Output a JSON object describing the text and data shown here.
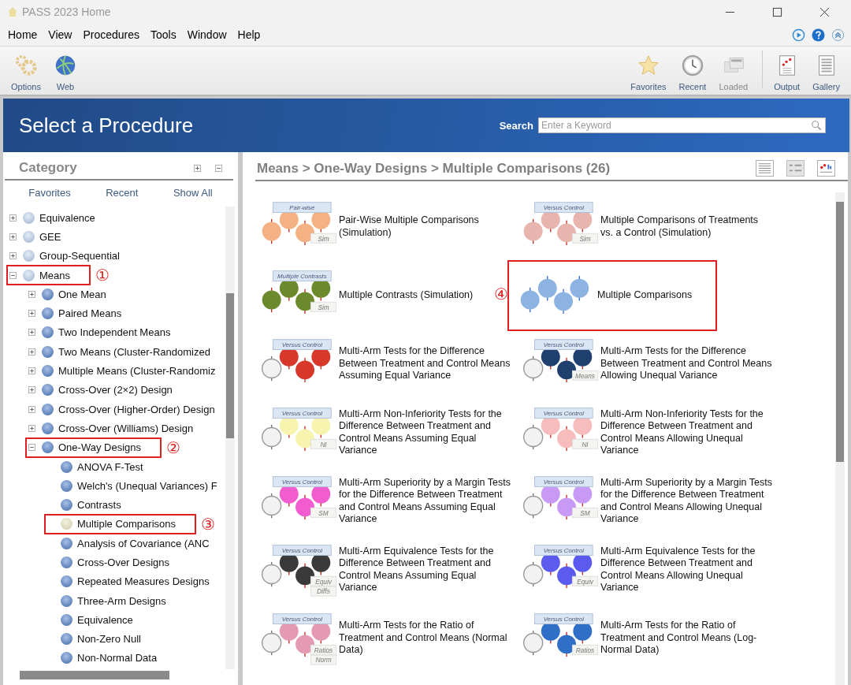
{
  "window": {
    "title": "PASS 2023 Home"
  },
  "menu": [
    "Home",
    "View",
    "Procedures",
    "Tools",
    "Window",
    "Help"
  ],
  "toolbar_left": [
    {
      "kind": "options",
      "label": "Options",
      "disabled": false
    },
    {
      "kind": "web",
      "label": "Web",
      "disabled": false
    }
  ],
  "toolbar_right": [
    {
      "kind": "favorites",
      "label": "Favorites",
      "disabled": false
    },
    {
      "kind": "recent",
      "label": "Recent",
      "disabled": false
    },
    {
      "kind": "loaded",
      "label": "Loaded",
      "disabled": true
    },
    {
      "kind": "output",
      "label": "Output",
      "disabled": false
    },
    {
      "kind": "gallery",
      "label": "Gallery",
      "disabled": false
    }
  ],
  "header": {
    "title": "Select a Procedure",
    "search_label": "Search",
    "search_placeholder": "Enter a Keyword"
  },
  "category": {
    "title": "Category",
    "tabs": [
      "Favorites",
      "Recent",
      "Show All"
    ],
    "tree": [
      {
        "label": "Equivalence",
        "expanded": false,
        "selected": false
      },
      {
        "label": "GEE",
        "expanded": false,
        "selected": false
      },
      {
        "label": "Group-Sequential",
        "expanded": false,
        "selected": false
      },
      {
        "label": "Means",
        "expanded": true,
        "selected": false,
        "callout": "①",
        "children": [
          {
            "label": "One Mean",
            "expanded": false,
            "selected": false
          },
          {
            "label": "Paired Means",
            "expanded": false,
            "selected": false
          },
          {
            "label": "Two Independent Means",
            "expanded": false,
            "selected": false
          },
          {
            "label": "Two Means (Cluster-Randomized",
            "expanded": false,
            "selected": false
          },
          {
            "label": "Multiple Means (Cluster-Randomiz",
            "expanded": false,
            "selected": false
          },
          {
            "label": "Cross-Over (2×2) Design",
            "expanded": false,
            "selected": false
          },
          {
            "label": "Cross-Over (Higher-Order) Design",
            "expanded": false,
            "selected": false
          },
          {
            "label": "Cross-Over (Williams) Design",
            "expanded": false,
            "selected": false
          },
          {
            "label": "One-Way Designs",
            "expanded": true,
            "selected": false,
            "callout": "②",
            "children": [
              {
                "label": "ANOVA F-Test",
                "selected": false
              },
              {
                "label": "Welch's (Unequal Variances) F",
                "selected": false
              },
              {
                "label": "Contrasts",
                "selected": false
              },
              {
                "label": "Multiple Comparisons",
                "selected": true,
                "callout": "③"
              },
              {
                "label": "Analysis of Covariance (ANC",
                "selected": false
              },
              {
                "label": "Cross-Over Designs",
                "selected": false
              },
              {
                "label": "Repeated Measures Designs",
                "selected": false
              },
              {
                "label": "Three-Arm Designs",
                "selected": false
              },
              {
                "label": "Equivalence",
                "selected": false
              },
              {
                "label": "Non-Zero Null",
                "selected": false
              },
              {
                "label": "Non-Normal Data",
                "selected": false
              }
            ]
          }
        ]
      }
    ]
  },
  "procedures": {
    "breadcrumb": "Means > One-Way Designs > Multiple Comparisons (26)",
    "items": [
      {
        "title": "Pair-Wise Multiple Comparisons (Simulation)",
        "color": "#f4b183",
        "banner": "Pair-wise",
        "control": false,
        "tags": [
          "Sim"
        ]
      },
      {
        "title": "Multiple Comparisons of Treatments vs. a Control (Simulation)",
        "color": "#e8b4ae",
        "banner": "Versus Control",
        "control": false,
        "tags": [
          "Sim"
        ]
      },
      {
        "title": "Multiple Contrasts (Simulation)",
        "color": "#6b8a2c",
        "banner": "Multiple Contrasts",
        "control": false,
        "tags": [
          "Sim"
        ]
      },
      {
        "title": "Multiple Comparisons",
        "color": "#8db3e2",
        "control": false,
        "callout": "④"
      },
      {
        "title": "Multi-Arm Tests for the Difference Between Treatment and Control Means Assuming Equal Variance",
        "color": "#d8382a",
        "banner": "Versus Control",
        "control": true
      },
      {
        "title": "Multi-Arm Tests for the Difference Between Treatment and Control Means Allowing Unequal Variance",
        "color": "#1f3f6e",
        "banner": "Versus Control",
        "control": true,
        "tags": [
          "Means"
        ]
      },
      {
        "title": "Multi-Arm Non-Inferiority Tests for the Difference Between Treatment and Control Means Assuming Equal Variance",
        "color": "#f7f4b0",
        "banner": "Versus Control",
        "control": true,
        "tags": [
          "NI"
        ]
      },
      {
        "title": "Multi-Arm Non-Inferiority Tests for the Difference Between Treatment and Control Means Allowing Unequal Variance",
        "color": "#f7bcbc",
        "banner": "Versus Control",
        "control": true,
        "tags": [
          "NI"
        ]
      },
      {
        "title": "Multi-Arm Superiority by a Margin Tests for the Difference Between Treatment and Control Means Assuming Equal Variance",
        "color": "#f25ccf",
        "banner": "Versus Control",
        "control": true,
        "tags": [
          "SM"
        ]
      },
      {
        "title": "Multi-Arm Superiority by a Margin Tests for the Difference Between Treatment and Control Means Allowing Unequal Variance",
        "color": "#c99af5",
        "banner": "Versus Control",
        "control": true,
        "tags": [
          "SM"
        ]
      },
      {
        "title": "Multi-Arm Equivalence Tests for the Difference Between Treatment and Control Means Assuming Equal Variance",
        "color": "#3a3a3a",
        "banner": "Versus Control",
        "control": true,
        "tags": [
          "Equiv",
          "Diffs"
        ]
      },
      {
        "title": "Multi-Arm Equivalence Tests for the Difference Between Treatment and Control Means Allowing Unequal Variance",
        "color": "#5b5bf0",
        "banner": "Versus Control",
        "control": true,
        "tags": [
          "Equiv"
        ]
      },
      {
        "title": "Multi-Arm Tests for the Ratio of Treatment and Control Means (Normal Data)",
        "color": "#e59ab3",
        "banner": "Versus Control",
        "control": true,
        "tags": [
          "Ratios",
          "Norm"
        ]
      },
      {
        "title": "Multi-Arm Tests for the Ratio of Treatment and Control Means (Log-Normal Data)",
        "color": "#2f6fc8",
        "banner": "Versus Control",
        "control": true,
        "tags": [
          "Ratios"
        ]
      }
    ]
  }
}
